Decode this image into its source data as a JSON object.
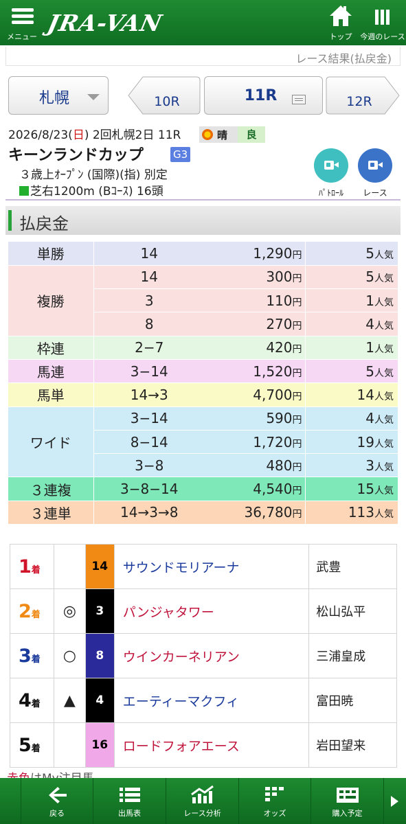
{
  "header": {
    "menu_label": "メニュー",
    "logo_text": "JRA-VAN",
    "top_label": "トップ",
    "week_label": "今週のレース"
  },
  "subheader": {
    "link": "レース結果(払戻金)"
  },
  "nav": {
    "venue": "札幌",
    "prev_race": "10R",
    "current_race": "11R",
    "next_race": "12R"
  },
  "race": {
    "date_prefix": "2026/8/23(",
    "weekday": "日",
    "date_suffix": ") 2回札幌2日 11R",
    "weather": "晴",
    "going": "良",
    "name": "キーンランドカップ",
    "grade": "G3",
    "conditions": "３歳上ｵｰﾌﾟﾝ (国際)(指) 別定",
    "course": "芝右1200m (Bｺｰｽ) 16頭",
    "patrol_label": "ﾊﾟﾄﾛｰﾙ",
    "race_video_label": "レース"
  },
  "section_title": "払戻金",
  "payouts": [
    {
      "type": "単勝",
      "bg": "#e0e4f4",
      "rows": [
        {
          "combo": "14",
          "amount": "1,290",
          "unit": "円",
          "pop": "5",
          "pop_unit": "人気"
        }
      ]
    },
    {
      "type": "複勝",
      "bg": "#fbe0e0",
      "rows": [
        {
          "combo": "14",
          "amount": "300",
          "unit": "円",
          "pop": "5",
          "pop_unit": "人気"
        },
        {
          "combo": "3",
          "amount": "110",
          "unit": "円",
          "pop": "1",
          "pop_unit": "人気"
        },
        {
          "combo": "8",
          "amount": "270",
          "unit": "円",
          "pop": "4",
          "pop_unit": "人気"
        }
      ]
    },
    {
      "type": "枠連",
      "bg": "#e4f7e2",
      "rows": [
        {
          "combo": "2−7",
          "amount": "420",
          "unit": "円",
          "pop": "1",
          "pop_unit": "人気"
        }
      ]
    },
    {
      "type": "馬連",
      "bg": "#f6d8f4",
      "rows": [
        {
          "combo": "3−14",
          "amount": "1,520",
          "unit": "円",
          "pop": "5",
          "pop_unit": "人気"
        }
      ]
    },
    {
      "type": "馬単",
      "bg": "#fafac6",
      "rows": [
        {
          "combo": "14→3",
          "amount": "4,700",
          "unit": "円",
          "pop": "14",
          "pop_unit": "人気"
        }
      ]
    },
    {
      "type": "ワイド",
      "bg": "#cdecf8",
      "rows": [
        {
          "combo": "3−14",
          "amount": "590",
          "unit": "円",
          "pop": "4",
          "pop_unit": "人気"
        },
        {
          "combo": "8−14",
          "amount": "1,720",
          "unit": "円",
          "pop": "19",
          "pop_unit": "人気"
        },
        {
          "combo": "3−8",
          "amount": "480",
          "unit": "円",
          "pop": "3",
          "pop_unit": "人気"
        }
      ]
    },
    {
      "type": "３連複",
      "bg": "#7ee8b8",
      "rows": [
        {
          "combo": "3−8−14",
          "amount": "4,540",
          "unit": "円",
          "pop": "15",
          "pop_unit": "人気"
        }
      ]
    },
    {
      "type": "３連単",
      "bg": "#fcd6b6",
      "rows": [
        {
          "combo": "14→3→8",
          "amount": "36,780",
          "unit": "円",
          "pop": "113",
          "pop_unit": "人気"
        }
      ]
    }
  ],
  "finish": [
    {
      "rank": "1",
      "rank_color": "#d0142c",
      "suffix": "着",
      "mark": "",
      "number": "14",
      "num_bg": "#f08a14",
      "num_color": "#000000",
      "horse": "サウンドモリアーナ",
      "horse_color": "#1a3a9c",
      "jockey": "武豊"
    },
    {
      "rank": "2",
      "rank_color": "#f08a14",
      "suffix": "着",
      "mark": "◎",
      "number": "3",
      "num_bg": "#000000",
      "num_color": "#ffffff",
      "horse": "パンジャタワー",
      "horse_color": "#c0143c",
      "jockey": "松山弘平"
    },
    {
      "rank": "3",
      "rank_color": "#1a3a9c",
      "suffix": "着",
      "mark": "○",
      "number": "8",
      "num_bg": "#2a2a9a",
      "num_color": "#ffffff",
      "horse": "ウインカーネリアン",
      "horse_color": "#c0143c",
      "jockey": "三浦皇成"
    },
    {
      "rank": "4",
      "rank_color": "#111111",
      "suffix": "着",
      "mark": "▲",
      "number": "4",
      "num_bg": "#000000",
      "num_color": "#ffffff",
      "horse": "エーティーマクフィ",
      "horse_color": "#1a3a9c",
      "jockey": "富田暁"
    },
    {
      "rank": "5",
      "rank_color": "#111111",
      "suffix": "着",
      "mark": "",
      "number": "16",
      "num_bg": "#f0a8e8",
      "num_color": "#000000",
      "horse": "ロードフォアエース",
      "horse_color": "#c0143c",
      "jockey": "岩田望来"
    }
  ],
  "footnote": {
    "red": "赤色",
    "rest": "はMy注目馬"
  },
  "toolbar": {
    "back": "戻る",
    "entries": "出馬表",
    "analysis": "レース分析",
    "odds": "オッズ",
    "plan": "購入予定"
  }
}
